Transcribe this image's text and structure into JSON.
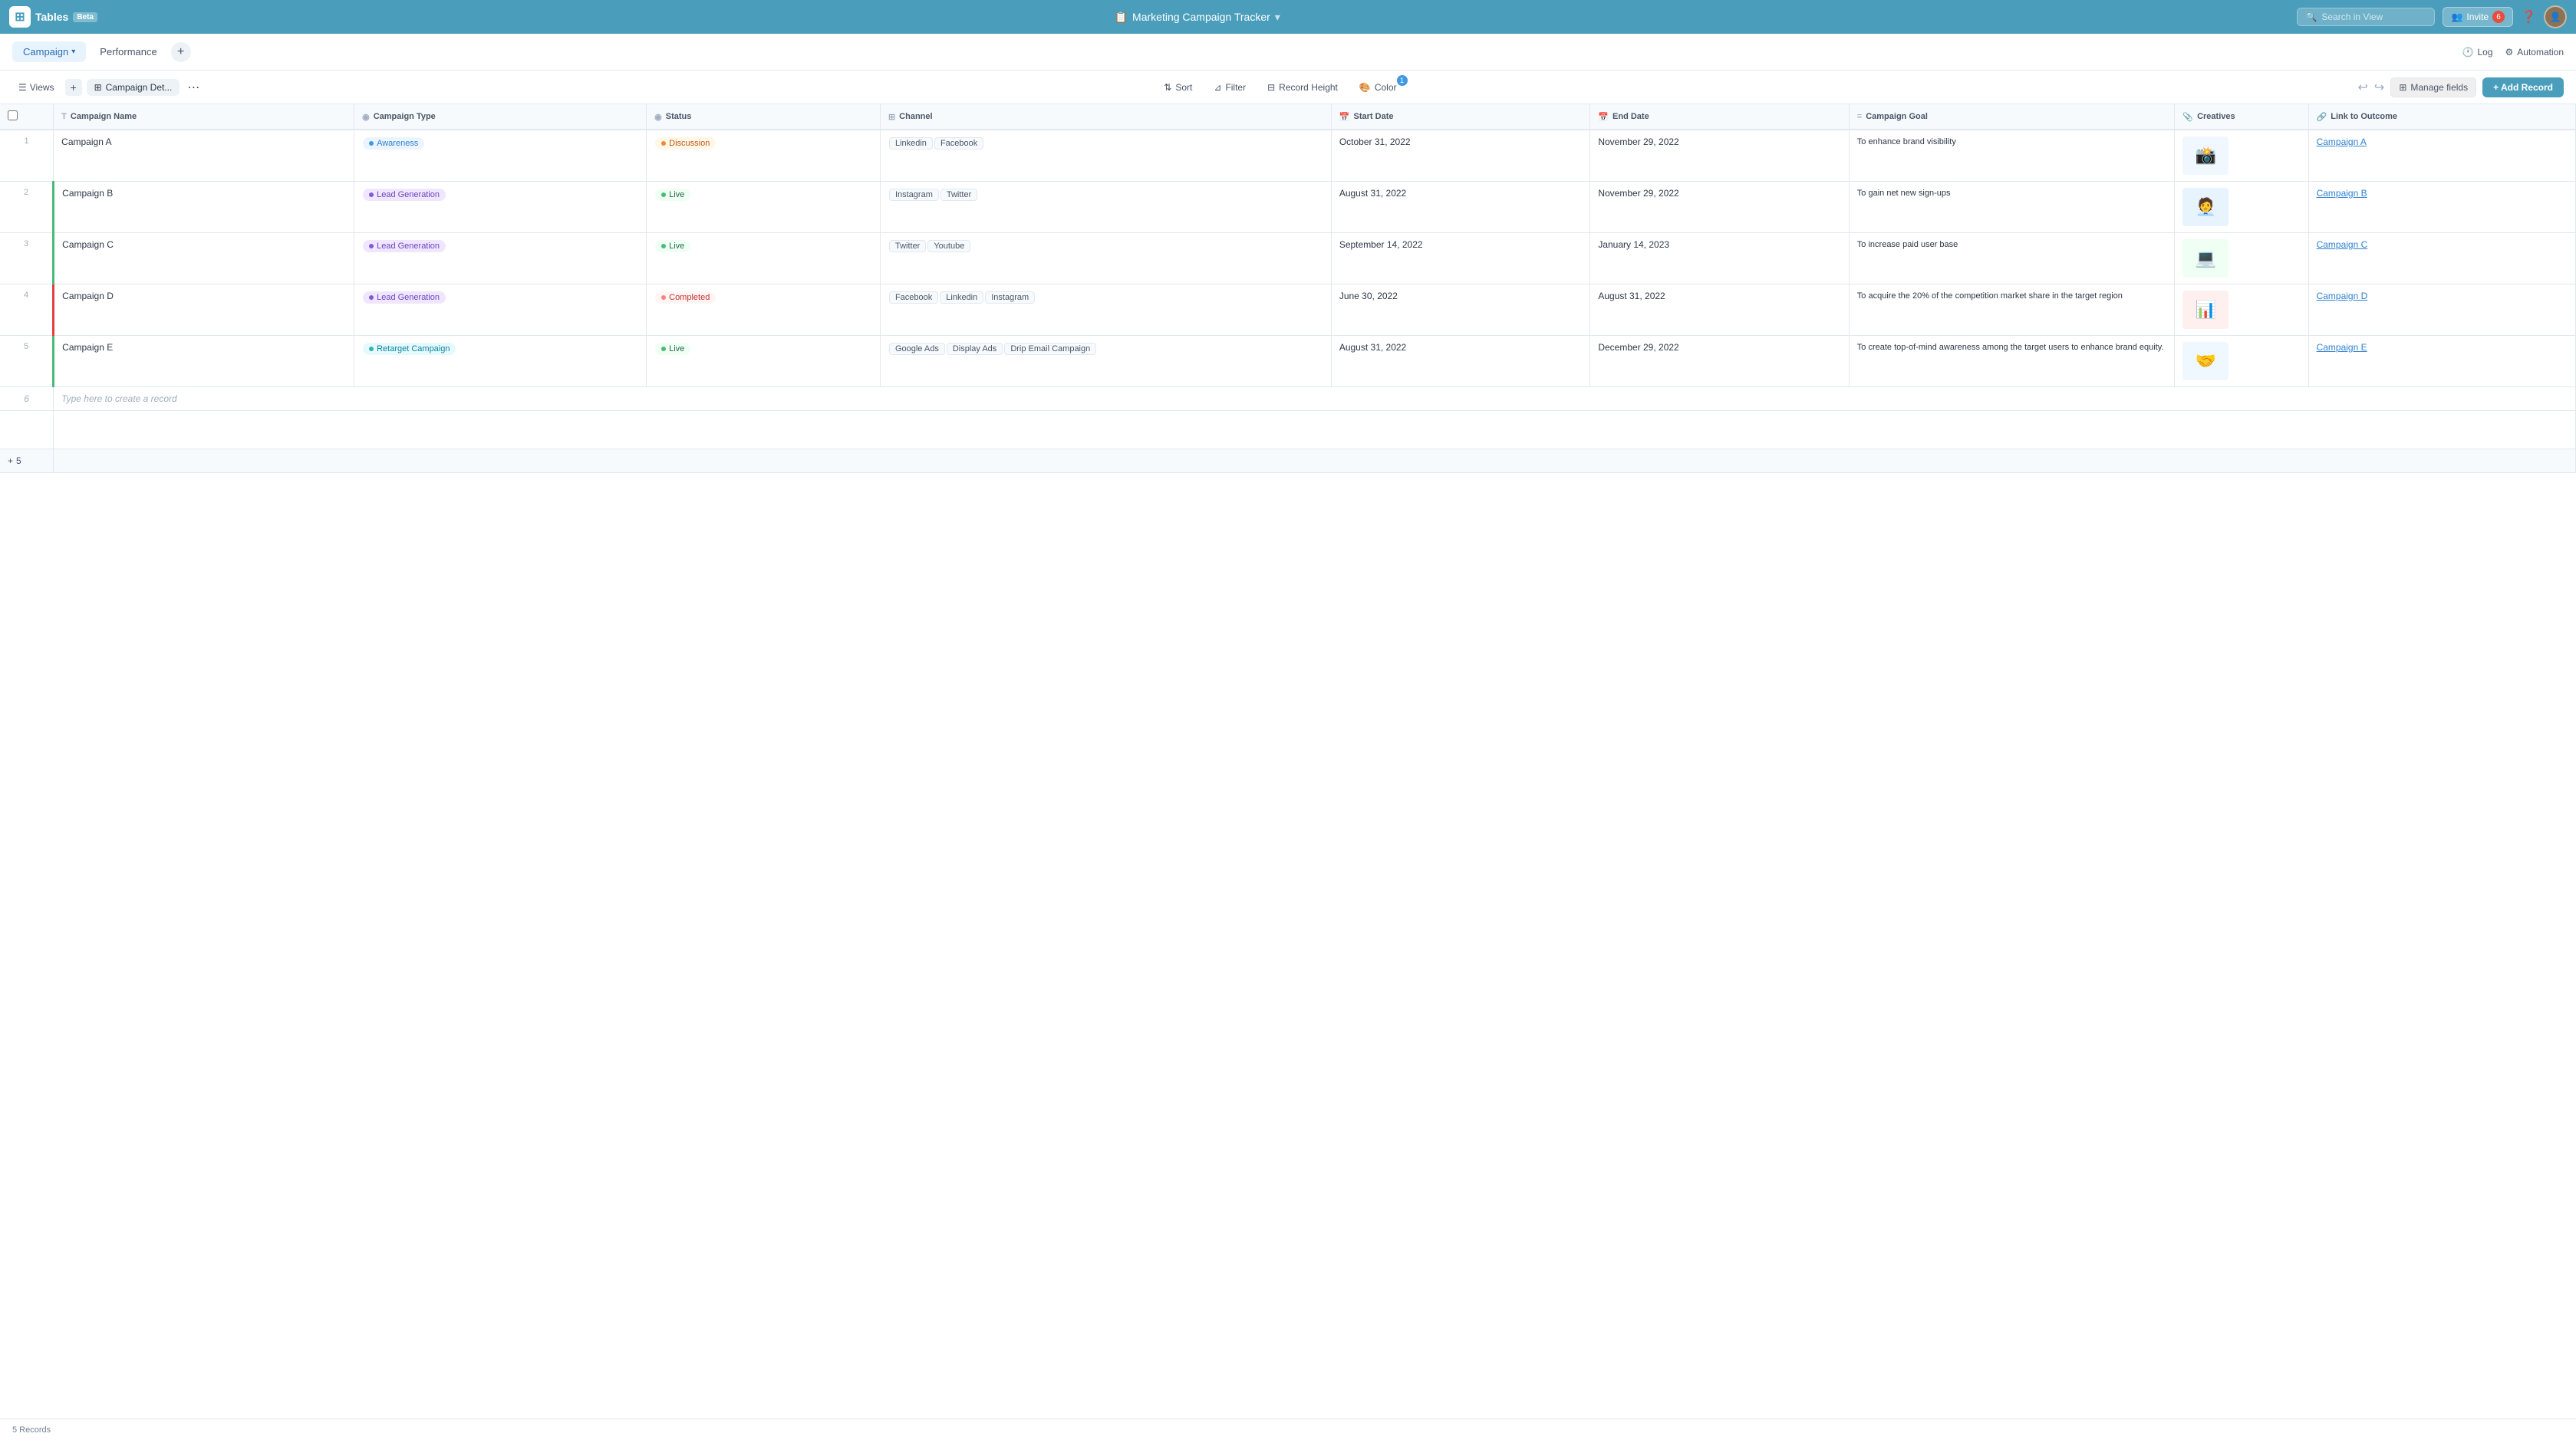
{
  "app": {
    "logo_text": "Tables",
    "beta_label": "Beta",
    "title": "Marketing Campaign Tracker",
    "title_icon": "📋"
  },
  "nav": {
    "search_placeholder": "Search in View",
    "invite_label": "Invite",
    "invite_count": "6",
    "log_label": "Log",
    "automation_label": "Automation"
  },
  "tabs": [
    {
      "label": "Campaign",
      "active": true,
      "has_dropdown": true
    },
    {
      "label": "Performance",
      "active": false
    }
  ],
  "toolbar": {
    "views_label": "Views",
    "view_name": "Campaign Det...",
    "sort_label": "Sort",
    "filter_label": "Filter",
    "record_height_label": "Record Height",
    "color_label": "Color",
    "color_badge": "1",
    "manage_fields_label": "Manage fields",
    "add_record_label": "+ Add Record",
    "undo_icon": "↩",
    "redo_icon": "↪"
  },
  "columns": [
    {
      "name": "Campaign Name",
      "type": "text",
      "icon": "T"
    },
    {
      "name": "Campaign Type",
      "type": "select",
      "icon": "◉"
    },
    {
      "name": "Status",
      "type": "select",
      "icon": "◉"
    },
    {
      "name": "Channel",
      "type": "multi",
      "icon": "⊞"
    },
    {
      "name": "Start Date",
      "type": "date",
      "icon": "📅"
    },
    {
      "name": "End Date",
      "type": "date",
      "icon": "📅"
    },
    {
      "name": "Campaign Goal",
      "type": "text",
      "icon": "≡"
    },
    {
      "name": "Creatives",
      "type": "attachment",
      "icon": "📎"
    },
    {
      "name": "Link to Outcome",
      "type": "link",
      "icon": "🔗"
    }
  ],
  "rows": [
    {
      "num": "1",
      "campaign_name": "Campaign A",
      "campaign_type": "Awareness",
      "campaign_type_style": "awareness",
      "status": "Discussion",
      "status_style": "discussion",
      "channels": [
        "Linkedin",
        "Facebook"
      ],
      "start_date": "October 31, 2022",
      "end_date": "November 29, 2022",
      "campaign_goal": "To enhance brand visibility",
      "link_to_outcome": "Campaign A",
      "border": "none"
    },
    {
      "num": "2",
      "campaign_name": "Campaign B",
      "campaign_type": "Lead Generation",
      "campaign_type_style": "lead",
      "status": "Live",
      "status_style": "live",
      "channels": [
        "Instagram",
        "Twitter"
      ],
      "start_date": "August 31, 2022",
      "end_date": "November 29, 2022",
      "campaign_goal": "To gain net new sign-ups",
      "link_to_outcome": "Campaign B",
      "border": "green"
    },
    {
      "num": "3",
      "campaign_name": "Campaign C",
      "campaign_type": "Lead Generation",
      "campaign_type_style": "lead",
      "status": "Live",
      "status_style": "live",
      "channels": [
        "Twitter",
        "Youtube"
      ],
      "start_date": "September 14, 2022",
      "end_date": "January 14, 2023",
      "campaign_goal": "To increase paid user base",
      "link_to_outcome": "Campaign C",
      "border": "green"
    },
    {
      "num": "4",
      "campaign_name": "Campaign D",
      "campaign_type": "Lead Generation",
      "campaign_type_style": "lead",
      "status": "Completed",
      "status_style": "completed",
      "channels": [
        "Facebook",
        "Linkedin",
        "Instagram"
      ],
      "start_date": "June 30, 2022",
      "end_date": "August 31, 2022",
      "campaign_goal": "To acquire the 20% of the competition market share in the target region",
      "link_to_outcome": "Campaign D",
      "border": "red"
    },
    {
      "num": "5",
      "campaign_name": "Campaign E",
      "campaign_type": "Retarget Campaign",
      "campaign_type_style": "retarget",
      "status": "Live",
      "status_style": "live",
      "channels": [
        "Google Ads",
        "Display Ads",
        "Drip Email Campaign"
      ],
      "start_date": "August 31, 2022",
      "end_date": "December 29, 2022",
      "campaign_goal": "To create top-of-mind awareness among the target users to enhance brand equity.",
      "link_to_outcome": "Campaign E",
      "border": "green"
    }
  ],
  "create_row_placeholder": "Type here to create a record",
  "status_bar": {
    "record_count": "5 Records"
  }
}
